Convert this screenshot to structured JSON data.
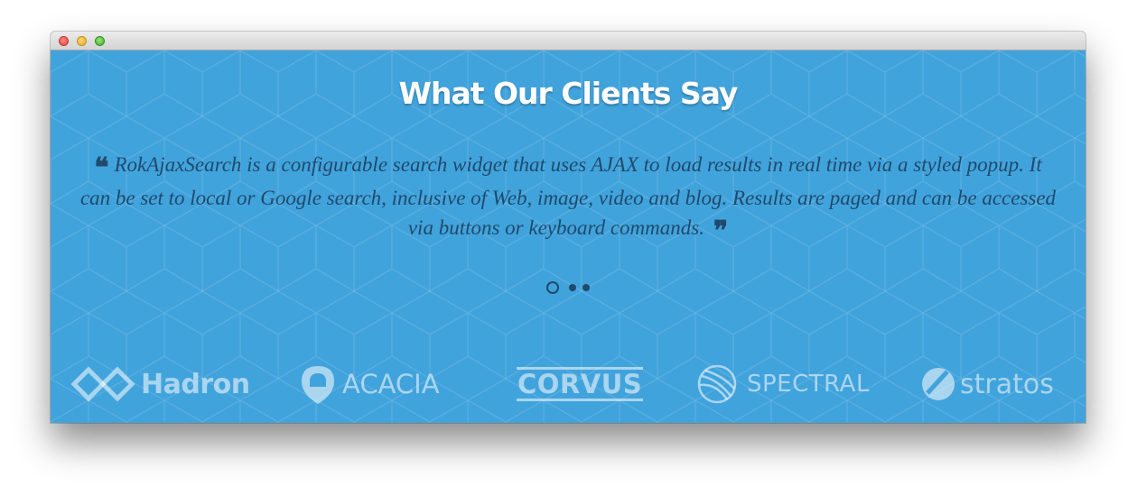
{
  "window": {
    "controls": [
      "close",
      "minimize",
      "maximize"
    ]
  },
  "section": {
    "title": "What Our Clients Say",
    "background_color": "#41a3dc",
    "text_color": "#1f4a6b"
  },
  "testimonial": {
    "open_mark": "❝",
    "text": "RokAjaxSearch is a configurable search widget that uses AJAX to load results in real time via a styled popup. It can be set to local or Google search, inclusive of Web, image, video and blog. Results are paged and can be accessed via buttons or keyboard commands.",
    "close_mark": "❞"
  },
  "pagination": {
    "total": 3,
    "active_index": 0
  },
  "clients": [
    {
      "name": "Hadron",
      "icon": "hadron-diamond-icon"
    },
    {
      "name": "ACACIA",
      "icon": "acacia-shield-icon"
    },
    {
      "name": "CORVUS",
      "icon": ""
    },
    {
      "name": "SPECTRAL",
      "icon": "spectral-globe-icon"
    },
    {
      "name": "stratos",
      "icon": "stratos-circle-icon"
    }
  ]
}
